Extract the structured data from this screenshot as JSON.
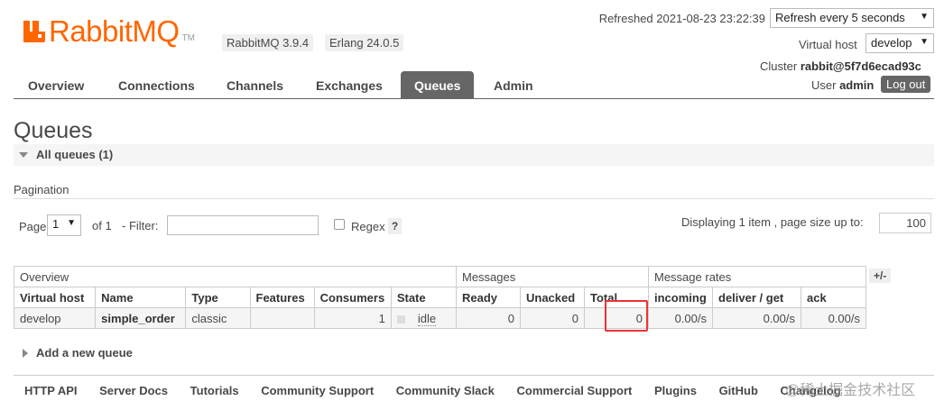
{
  "header": {
    "logo_text": "RabbitMQ",
    "logo_tm": "TM",
    "rabbit_version": "RabbitMQ 3.9.4",
    "erlang_version": "Erlang 24.0.5",
    "refreshed": "Refreshed 2021-08-23 23:22:39",
    "refresh_select": "Refresh every 5 seconds",
    "vhost_label": "Virtual host",
    "vhost_select": "develop",
    "cluster_label": "Cluster",
    "cluster_name": "rabbit@5f7d6ecad93c",
    "user_label": "User",
    "user_name": "admin",
    "logout": "Log out"
  },
  "nav": {
    "tabs": [
      {
        "label": "Overview"
      },
      {
        "label": "Connections"
      },
      {
        "label": "Channels"
      },
      {
        "label": "Exchanges"
      },
      {
        "label": "Queues",
        "active": true
      },
      {
        "label": "Admin"
      }
    ]
  },
  "page": {
    "title": "Queues",
    "section_title": "All queues (1)",
    "pagination_label": "Pagination",
    "page_label": "Page",
    "page_select": "1",
    "of_label": "of 1",
    "filter_label": "- Filter:",
    "regex_label": "Regex",
    "help_label": "?",
    "displaying": "Displaying 1 item , page size up to:",
    "page_size": "100"
  },
  "table": {
    "groups": [
      "Overview",
      "Messages",
      "Message rates"
    ],
    "plus_minus": "+/-",
    "columns": [
      "Virtual host",
      "Name",
      "Type",
      "Features",
      "Consumers",
      "State",
      "Ready",
      "Unacked",
      "Total",
      "incoming",
      "deliver / get",
      "ack"
    ],
    "rows": [
      {
        "vhost": "develop",
        "name": "simple_order",
        "type": "classic",
        "features": "",
        "consumers": "1",
        "state": "idle",
        "ready": "0",
        "unacked": "0",
        "total": "0",
        "incoming": "0.00/s",
        "deliver_get": "0.00/s",
        "ack": "0.00/s"
      }
    ]
  },
  "add_queue": "Add a new queue",
  "footer": {
    "links": [
      "HTTP API",
      "Server Docs",
      "Tutorials",
      "Community Support",
      "Community Slack",
      "Commercial Support",
      "Plugins",
      "GitHub",
      "Changelog"
    ]
  },
  "watermark": "@稀土掘金技术社区",
  "colors": {
    "brand": "#ff6600",
    "active_tab": "#666666",
    "highlight_box": "#e33333"
  }
}
